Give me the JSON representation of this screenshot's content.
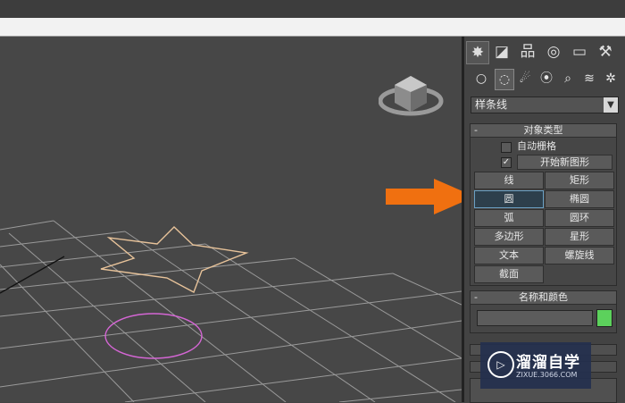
{
  "command_panel": {
    "tabs": [
      {
        "icon": "create-icon",
        "glyph": "✸",
        "active": true
      },
      {
        "icon": "modify-icon",
        "glyph": "◪"
      },
      {
        "icon": "hierarchy-icon",
        "glyph": "品"
      },
      {
        "icon": "motion-icon",
        "glyph": "◎"
      },
      {
        "icon": "display-icon",
        "glyph": "▭"
      },
      {
        "icon": "utilities-icon",
        "glyph": "⚒"
      }
    ],
    "subcategories": [
      {
        "icon": "geometry-icon",
        "glyph": "○"
      },
      {
        "icon": "shapes-icon",
        "glyph": "◌",
        "active": true
      },
      {
        "icon": "lights-icon",
        "glyph": "☄"
      },
      {
        "icon": "cameras-icon",
        "glyph": "⦿"
      },
      {
        "icon": "helpers-icon",
        "glyph": "⌕"
      },
      {
        "icon": "spacewarps-icon",
        "glyph": "≋"
      },
      {
        "icon": "systems-icon",
        "glyph": "✲"
      }
    ],
    "category_dropdown": "样条线",
    "object_type": {
      "title": "对象类型",
      "collapse": "-",
      "autogrid_label": "自动栅格",
      "start_new_shape_check": "✓",
      "start_new_shape_label": "开始新图形",
      "buttons": [
        "线",
        "矩形",
        "圆",
        "椭圆",
        "弧",
        "圆环",
        "多边形",
        "星形",
        "文本",
        "螺旋线",
        "截面"
      ],
      "active_button": "圆"
    },
    "name_color": {
      "title": "名称和颜色",
      "collapse": "-",
      "name_value": "",
      "color": "#5cd15c"
    }
  },
  "watermark": {
    "logo": "▷",
    "text": "溜溜自学",
    "url": "ZIXUE.3066.COM"
  },
  "colors": {
    "arrow": "#f07010",
    "star_spline": "#e8c39a",
    "circle_spline": "#d466d4",
    "grid": "#9a9a9a",
    "active_button_border": "#6aa0c4"
  }
}
